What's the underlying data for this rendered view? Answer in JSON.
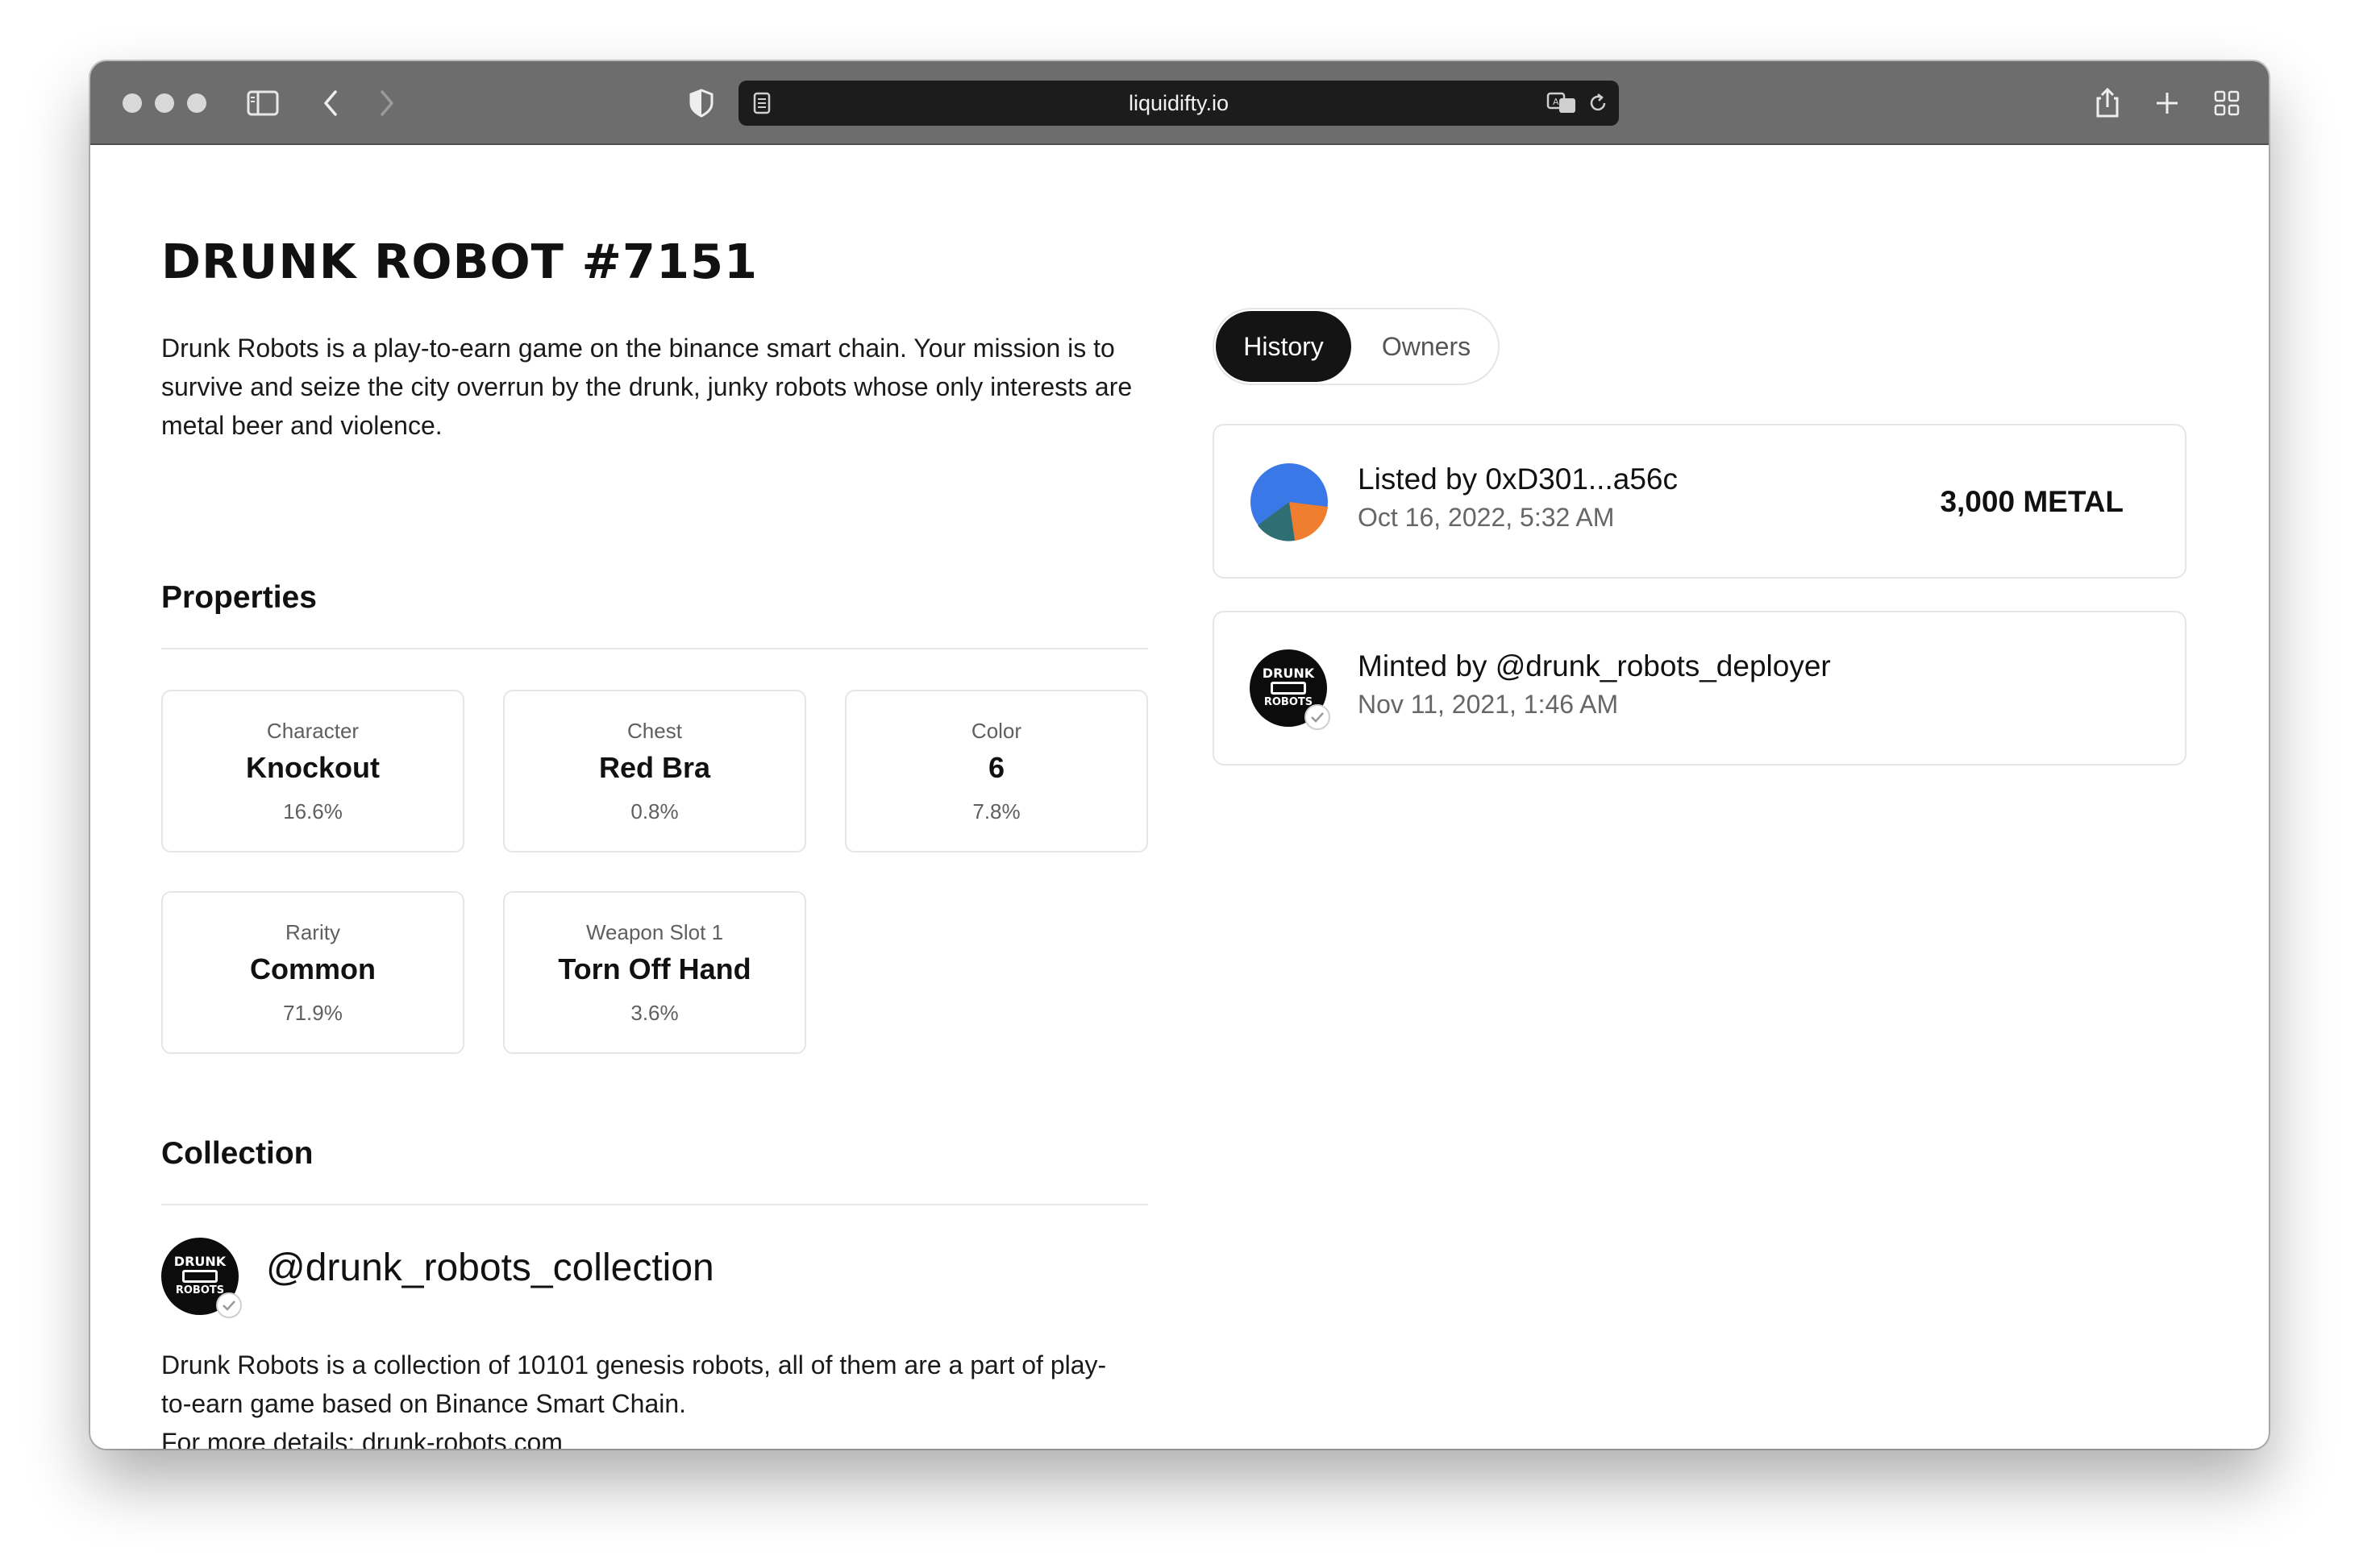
{
  "browser": {
    "url": "liquidifty.io"
  },
  "nft": {
    "title": "DRUNK ROBOT #7151",
    "description": "Drunk Robots is a play-to-earn game on the binance smart chain. Your mission is to survive and seize the city overrun by the drunk, junky robots whose only interests are metal beer and violence."
  },
  "properties": {
    "heading": "Properties",
    "items": [
      {
        "label": "Character",
        "value": "Knockout",
        "pct": "16.6%"
      },
      {
        "label": "Chest",
        "value": "Red Bra",
        "pct": "0.8%"
      },
      {
        "label": "Color",
        "value": "6",
        "pct": "7.8%"
      },
      {
        "label": "Rarity",
        "value": "Common",
        "pct": "71.9%"
      },
      {
        "label": "Weapon Slot 1",
        "value": "Torn Off Hand",
        "pct": "3.6%"
      }
    ]
  },
  "collection": {
    "heading": "Collection",
    "logo_line1": "DRUNK",
    "logo_line2": "ROBOTS",
    "name": "@drunk_robots_collection",
    "desc_line1": "Drunk Robots is a collection of 10101 genesis robots, all of them are a part of play-",
    "desc_line2": "to-earn game based on Binance Smart Chain.",
    "desc_line3": "For more details: drunk-robots.com"
  },
  "tabs": {
    "history": "History",
    "owners": "Owners"
  },
  "history": [
    {
      "primary": "Listed by 0xD301...a56c",
      "secondary": "Oct 16, 2022, 5:32 AM",
      "price": "3,000 METAL"
    },
    {
      "primary": "Minted by @drunk_robots_deployer",
      "secondary": "Nov 11, 2021, 1:46 AM"
    }
  ],
  "colors": {
    "accent_dark": "#141414",
    "avatar_blue": "#3b78e7",
    "avatar_orange": "#ef7f2e",
    "avatar_teal": "#2f6f73"
  },
  "icons": [
    "sidebar-icon",
    "back-icon",
    "forward-icon",
    "shield-icon",
    "page-icon",
    "translate-icon",
    "reload-icon",
    "share-icon",
    "new-tab-icon",
    "tab-overview-icon",
    "verified-check-icon"
  ]
}
